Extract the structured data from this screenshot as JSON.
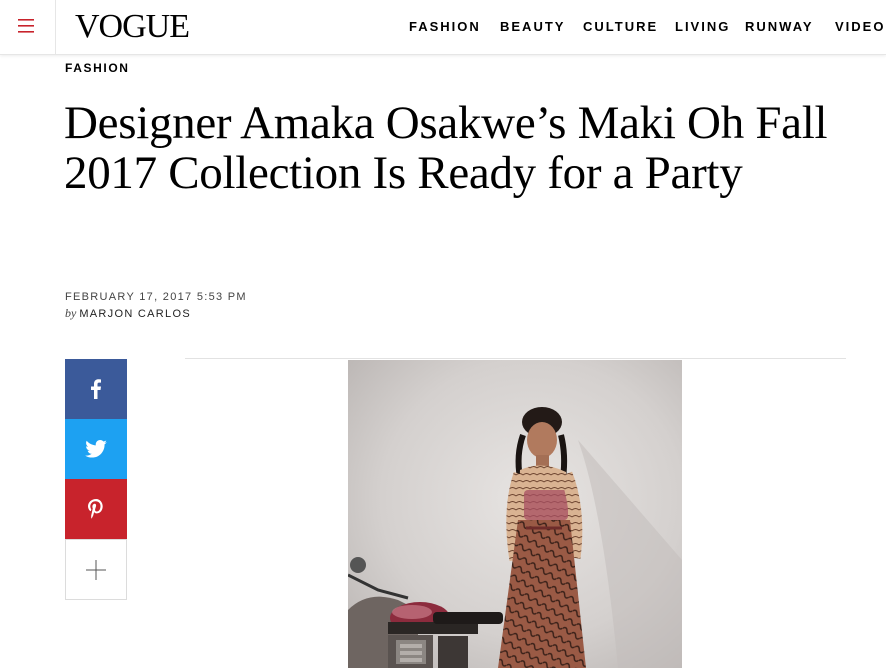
{
  "header": {
    "logo": "VOGUE",
    "nav": [
      "FASHION",
      "BEAUTY",
      "CULTURE",
      "LIVING",
      "RUNWAY",
      "VIDEO"
    ]
  },
  "article": {
    "kicker": "FASHION",
    "headline": "Designer Amaka Osakwe’s Maki Oh Fall 2017 Collection Is Ready for a Party",
    "date": "FEBRUARY 17, 2017 5:53 PM",
    "by_label": "by",
    "author": "MARJON CARLOS"
  },
  "share": {
    "icons": [
      "facebook-icon",
      "twitter-icon",
      "pinterest-icon",
      "plus-icon"
    ]
  },
  "colors": {
    "facebook": "#3b5a9a",
    "twitter": "#1da1f2",
    "pinterest": "#c8232c"
  }
}
